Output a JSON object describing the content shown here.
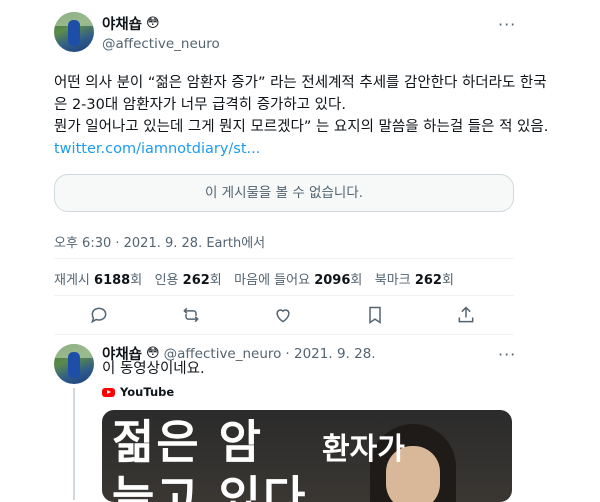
{
  "tweet": {
    "author_name": "야채숍",
    "emoji": "😳",
    "handle": "@affective_neuro",
    "more": "···",
    "text_lines": [
      "어떤 의사 분이 “젊은 암환자 증가” 라는 전세계적 추세를 감안한다 하더라도 한국",
      "은 2-30대 암환자가 너무 급격히 증가하고 있다.",
      "뭔가 일어나고 있는데 그게 뭔지 모르겠다” 는 요지의 말씀을 하는걸 들은 적 있음."
    ],
    "link": "twitter.com/iamnotdiary/st...",
    "quote_unavailable": "이 게시물을 볼 수 없습니다.",
    "timestamp": "오후 6:30 · 2021. 9. 28. Earth에서",
    "stats": {
      "retweets_label": "재게시",
      "retweets_value": "6188",
      "retweets_suffix": "회",
      "quotes_label": "인용",
      "quotes_value": "262",
      "quotes_suffix": "회",
      "likes_label": "마음에 들어요",
      "likes_value": "2096",
      "likes_suffix": "회",
      "bookmarks_label": "북마크",
      "bookmarks_value": "262",
      "bookmarks_suffix": "회"
    },
    "actions": [
      "reply-icon",
      "retweet-icon",
      "like-icon",
      "bookmark-icon",
      "share-icon"
    ]
  },
  "reply": {
    "author_name": "야채숍",
    "emoji": "😳",
    "handle": "@affective_neuro",
    "date": "· 2021. 9. 28.",
    "text": "이 동영상이네요.",
    "source_label": "YouTube",
    "thumbnail_text_1": "젊은 암",
    "thumbnail_text_2": "환자가",
    "thumbnail_text_3": "늘고 있다"
  },
  "colors": {
    "accent": "#1d9bf0",
    "secondary_text": "#536471",
    "border": "#cfd9de",
    "youtube_red": "#ff0000"
  }
}
